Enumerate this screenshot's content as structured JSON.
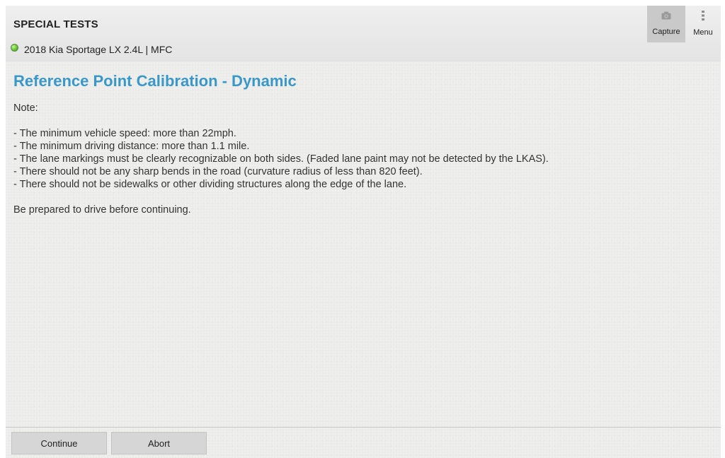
{
  "header": {
    "title": "SPECIAL TESTS",
    "vehicle": "2018 Kia Sportage LX 2.4L | MFC",
    "status_color": "#6fcf3a",
    "actions": [
      {
        "label": "Capture",
        "icon": "camera-icon"
      },
      {
        "label": "Menu",
        "icon": "more-vertical-icon"
      }
    ]
  },
  "main": {
    "title": "Reference Point Calibration - Dynamic",
    "title_color": "#3a98c9",
    "note_label": "Note:",
    "bullets": [
      "- The minimum vehicle speed: more than 22mph.",
      "- The minimum driving distance: more than 1.1 mile.",
      "- The lane markings must be clearly recognizable on both sides. (Faded lane paint may not be detected by the LKAS).",
      "- There should not be any sharp bends in the road (curvature radius of less than 820 feet).",
      "- There should not be sidewalks or other dividing structures along the edge of the lane."
    ],
    "prepare_text": "Be prepared to drive before continuing."
  },
  "footer": {
    "continue_label": "Continue",
    "abort_label": "Abort"
  }
}
